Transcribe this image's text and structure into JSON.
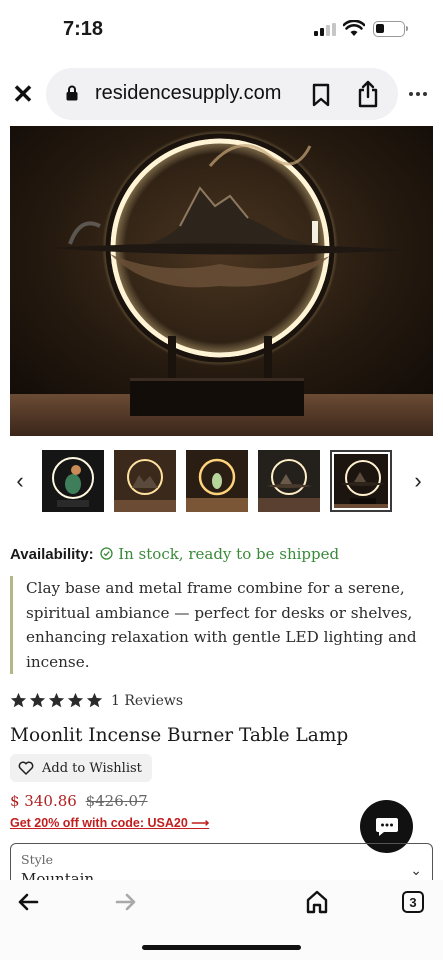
{
  "status_bar": {
    "time": "7:18"
  },
  "browser": {
    "url": "residencesupply.com",
    "icons": [
      "close-icon",
      "lock-icon",
      "bookmark-icon",
      "share-icon",
      "more-icon"
    ]
  },
  "gallery": {
    "thumbnail_count": 5,
    "active_thumbnail_index": 4,
    "prev_arrow": "‹",
    "next_arrow": "›"
  },
  "availability": {
    "label": "Availability:",
    "status": "In stock, ready to be shipped",
    "status_color": "#3a8a3a"
  },
  "description": "Clay base and metal frame combine for a serene, spiritual ambiance — perfect for desks or shelves, enhancing relaxation with gentle LED lighting and incense.",
  "reviews": {
    "rating": 5,
    "count_text": "1 Reviews"
  },
  "product": {
    "title": "Moonlit Incense Burner Table Lamp",
    "wishlist_label": "Add to Wishlist",
    "price_current": "$ 340.86",
    "price_original": "$426.07",
    "promo_text": "Get 20% off with code: USA20 ⟶",
    "price_color": "#b01f1f"
  },
  "style_select": {
    "label": "Style",
    "value": "Mountain"
  },
  "toolbar": {
    "tab_count": "3"
  }
}
